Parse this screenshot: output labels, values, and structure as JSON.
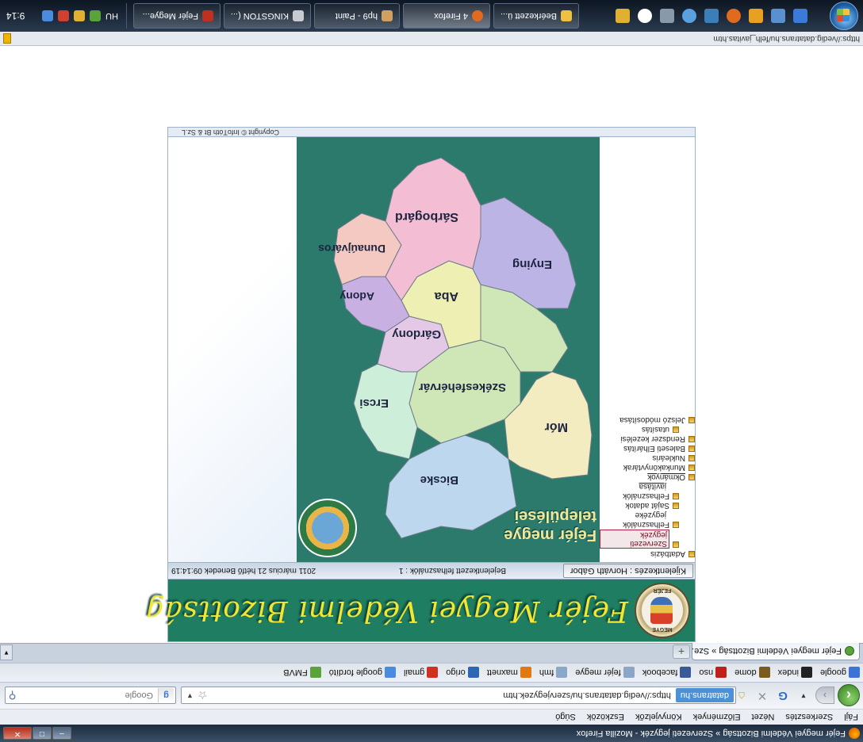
{
  "window": {
    "title": "Fejér megyei Védelmi Bizottság » Szervezeti jegyzék - Mozilla Firefox"
  },
  "menu": [
    "Fájl",
    "Szerkesztés",
    "Nézet",
    "Előzmények",
    "Könyvjelzők",
    "Eszközök",
    "Súgó"
  ],
  "navigation": {
    "site_label": "datatrans.hu",
    "url": "https://vedig.datatrans.hu/szervjegyzek.htm",
    "search_placeholder": "Google"
  },
  "bookmarks": [
    {
      "label": "google",
      "icon": "google-icon",
      "color": "#3b73d7"
    },
    {
      "label": "index",
      "icon": "index-icon",
      "color": "#222222"
    },
    {
      "label": "dome",
      "icon": "dome-icon",
      "color": "#7a5c1e"
    },
    {
      "label": "nso",
      "icon": "nso-icon",
      "color": "#c0201a"
    },
    {
      "label": "facebook",
      "icon": "facebook-icon",
      "color": "#3b5998"
    },
    {
      "label": "fejér megye",
      "icon": "page-icon",
      "color": "#8aa6c8"
    },
    {
      "label": "fmh",
      "icon": "page-icon",
      "color": "#8aa6c8"
    },
    {
      "label": "maxnett",
      "icon": "maxnett-icon",
      "color": "#e07a10"
    },
    {
      "label": "origo",
      "icon": "origo-icon",
      "color": "#2c66b5"
    },
    {
      "label": "gmail",
      "icon": "gmail-icon",
      "color": "#d0321f"
    },
    {
      "label": "google fordító",
      "icon": "translate-icon",
      "color": "#4a8be0"
    },
    {
      "label": "FMVB",
      "icon": "fmvb-icon",
      "color": "#5aa33a"
    }
  ],
  "tabs": [
    {
      "label": "Fejér megyei Védelmi Bizottság » Sze..."
    }
  ],
  "page": {
    "banner_title": "Fejér Megyei Védelmi Bizottság",
    "logo_top_text": "MEGYE",
    "logo_bottom_text": "FEJÉR",
    "logout_label": "Kijelentkezés : Horváth Gábor",
    "logged_users": "Bejelentkezett felhasználók : 1",
    "date_text": "2011 március 21 hétfő Benedek 09:14:19",
    "copyright": "Copyright © InfoTóth Bt & Sz.L",
    "map_title_line1": "Fejér megye",
    "map_title_line2": "települései",
    "left_nav": [
      {
        "label": "Adatbázis",
        "level": 0
      },
      {
        "label": "Szervezeti jegyzék",
        "level": 1,
        "selected": true
      },
      {
        "label": "Felhasználók",
        "level": 1
      },
      {
        "label": "jegyzéke",
        "level": 2
      },
      {
        "label": "Saját adatok",
        "level": 1
      },
      {
        "label": "Felhasználók",
        "level": 1
      },
      {
        "label": "javítása",
        "level": 2,
        "underline": true
      },
      {
        "label": "Okmányok",
        "level": 0,
        "underline": true
      },
      {
        "label": "Munkakönyvtárak",
        "level": 0
      },
      {
        "label": "Nukleáris",
        "level": 0
      },
      {
        "label": "Baleseti Elhárítás",
        "level": 0
      },
      {
        "label": "Rendszer kezelési",
        "level": 0
      },
      {
        "label": "utasítás",
        "level": 1
      },
      {
        "label": "Jelszó módosítása",
        "level": 0
      }
    ],
    "map_regions": [
      {
        "name": "Mór",
        "color": "#f3ecc0"
      },
      {
        "name": "Bicske",
        "color": "#bcd7ee"
      },
      {
        "name": "Székesfehérvár",
        "color": "#cfe7b6"
      },
      {
        "name": "Aba",
        "color": "#eef0b3"
      },
      {
        "name": "Gárdony",
        "color": "#e3c9e6"
      },
      {
        "name": "Ercsi",
        "color": "#cdeed8"
      },
      {
        "name": "Adony",
        "color": "#c9b0e2"
      },
      {
        "name": "Dunaújváros",
        "color": "#f3c9c2"
      },
      {
        "name": "Sárbogárd",
        "color": "#f3bdd3"
      },
      {
        "name": "Enying",
        "color": "#bdb4e6"
      }
    ]
  },
  "statusbar": {
    "text": "https://vedig.datatrans.hu/felh_javitas.htm"
  },
  "taskbar": {
    "buttons": [
      {
        "label": "Fejér Megye...",
        "active": false
      },
      {
        "label": "KINGSTON (...",
        "active": false
      },
      {
        "label": "hp9 - Paint",
        "active": false
      },
      {
        "label": "4 Firefox",
        "active": true
      },
      {
        "label": "Beérkezett ü...",
        "active": false
      }
    ],
    "tray_lang": "HU",
    "clock": "9:14"
  }
}
